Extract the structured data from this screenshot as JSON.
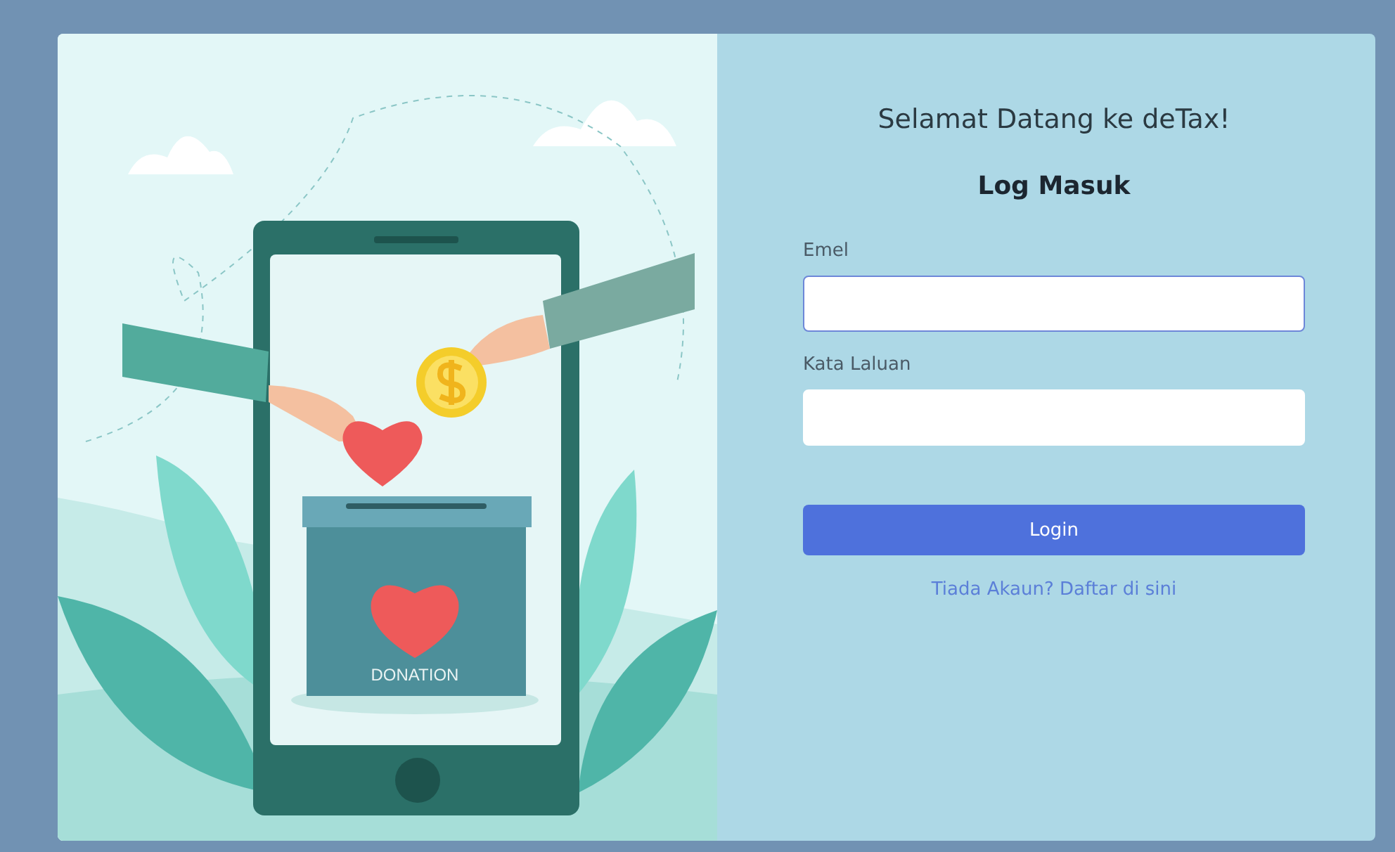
{
  "illustration": {
    "box_label": "DONATION"
  },
  "login": {
    "greeting": "Selamat Datang ke deTax!",
    "title": "Log Masuk",
    "fields": [
      {
        "label": "Emel",
        "focused": true
      },
      {
        "label": "Kata Laluan",
        "focused": false
      }
    ],
    "submit": "Login",
    "signup_link": "Tiada Akaun? Daftar di sini"
  }
}
